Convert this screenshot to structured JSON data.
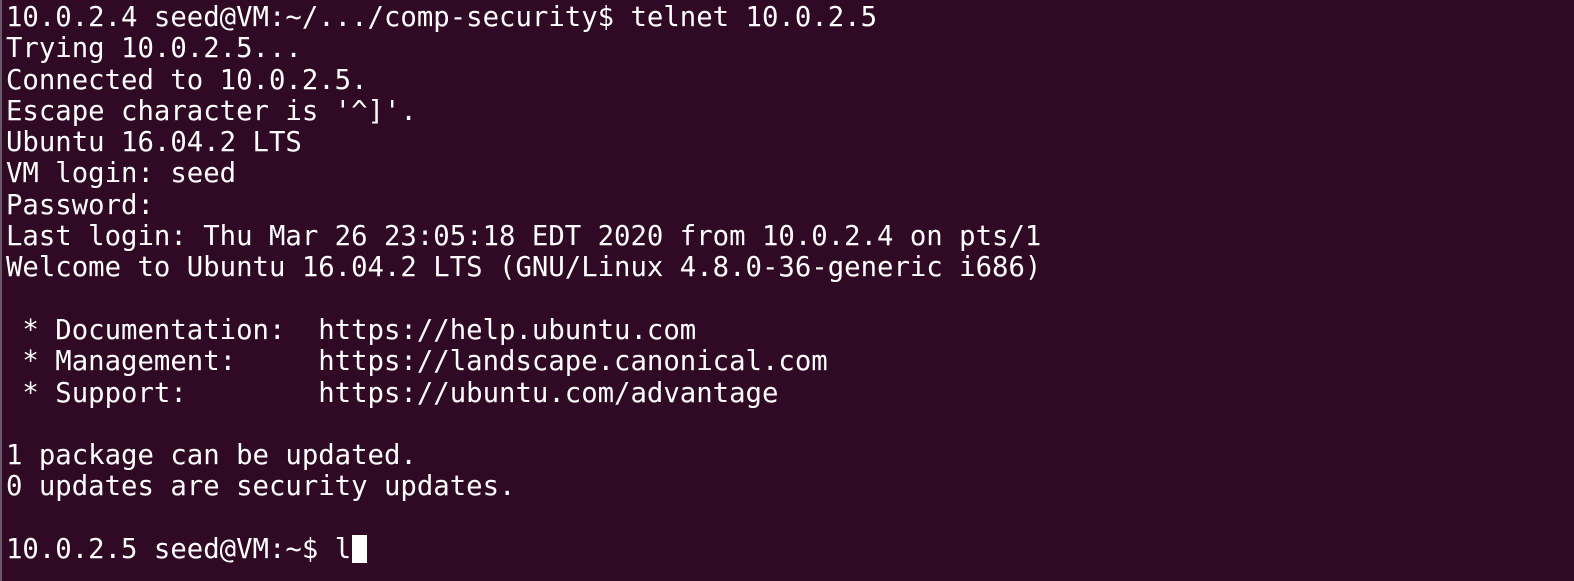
{
  "terminal": {
    "lines": [
      "10.0.2.4 seed@VM:~/.../comp-security$ telnet 10.0.2.5",
      "Trying 10.0.2.5...",
      "Connected to 10.0.2.5.",
      "Escape character is '^]'.",
      "Ubuntu 16.04.2 LTS",
      "VM login: seed",
      "Password: ",
      "Last login: Thu Mar 26 23:05:18 EDT 2020 from 10.0.2.4 on pts/1",
      "Welcome to Ubuntu 16.04.2 LTS (GNU/Linux 4.8.0-36-generic i686)",
      "",
      " * Documentation:  https://help.ubuntu.com",
      " * Management:     https://landscape.canonical.com",
      " * Support:        https://ubuntu.com/advantage",
      "",
      "1 package can be updated.",
      "0 updates are security updates.",
      ""
    ],
    "prompt": "10.0.2.5 seed@VM:~$ ",
    "input": "l"
  }
}
